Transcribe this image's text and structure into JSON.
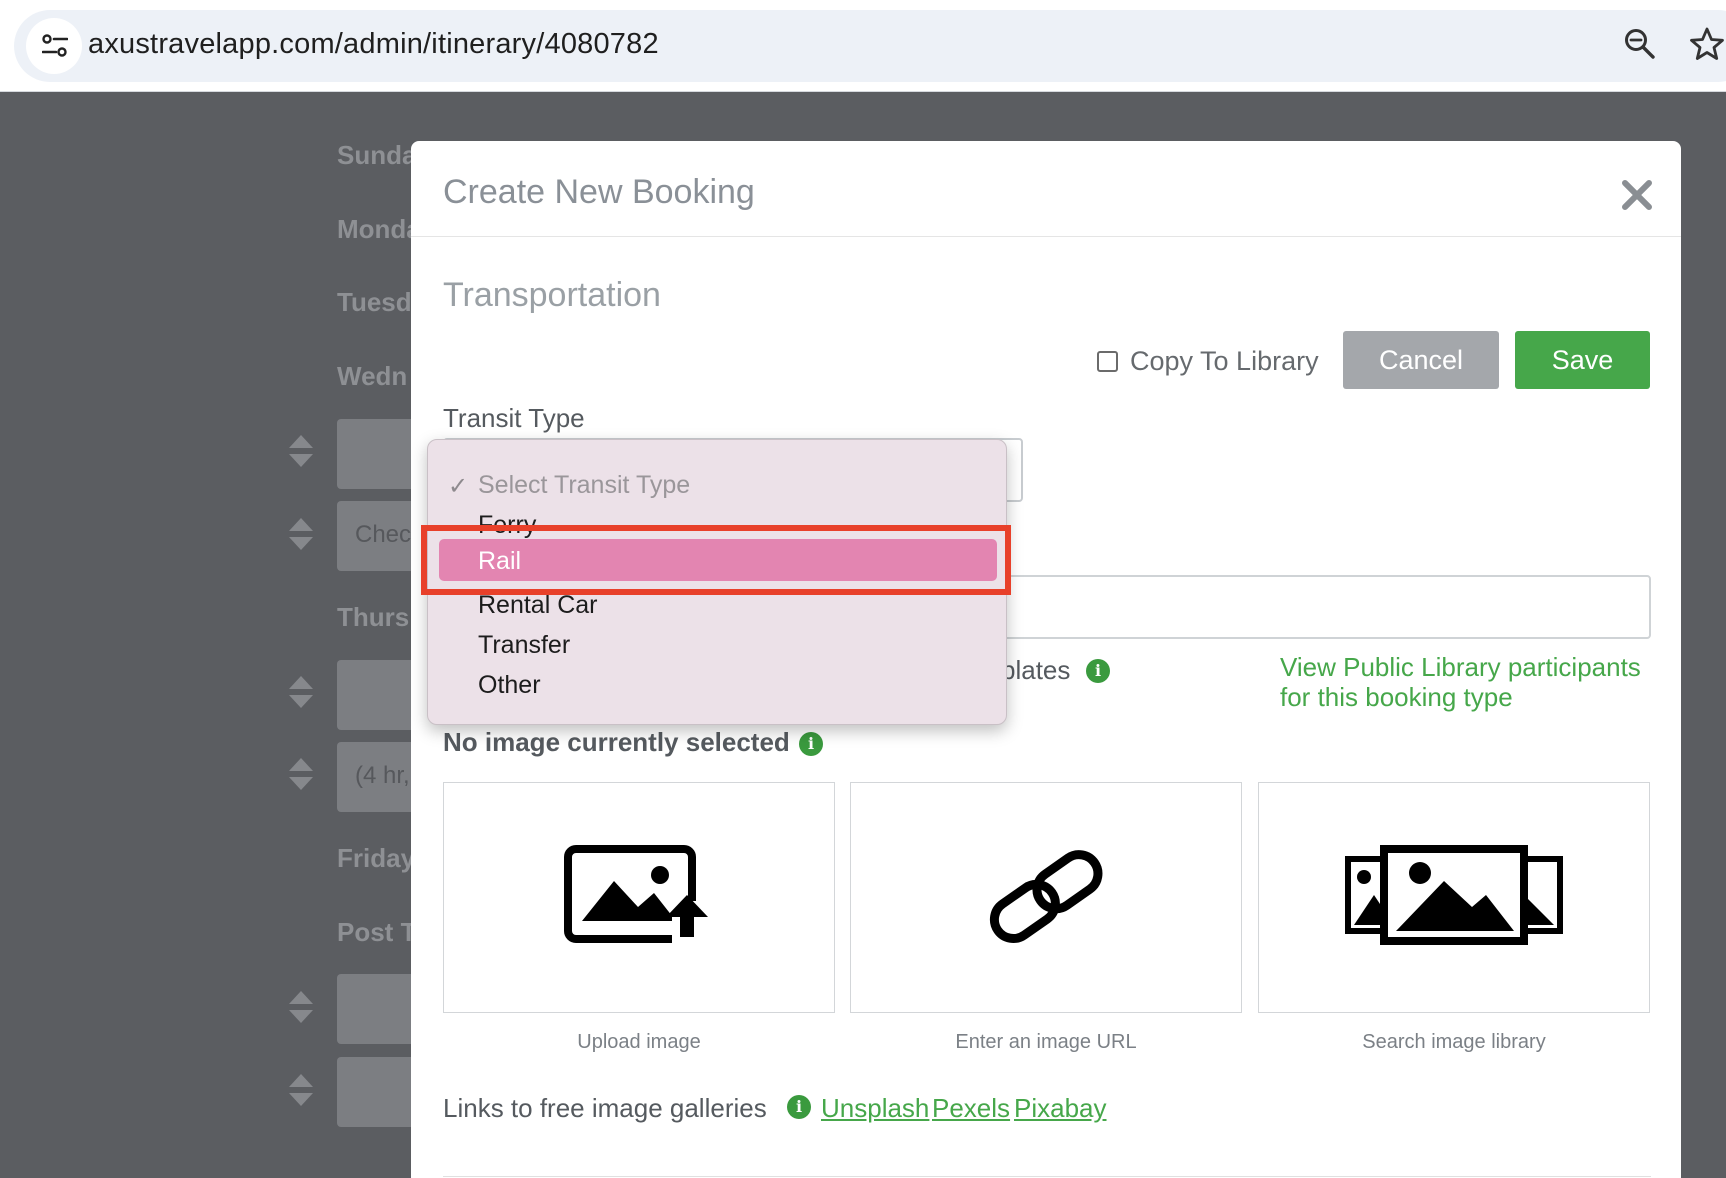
{
  "browser": {
    "url": "axustravelapp.com/admin/itinerary/4080782"
  },
  "background_page": {
    "days": [
      "Sunda",
      "Monda",
      "Tuesd",
      "Wedn",
      "Thurs",
      "Friday",
      "Post T"
    ],
    "box_texts": [
      "Chec",
      "(4 hr,"
    ]
  },
  "modal": {
    "title": "Create New Booking",
    "section_title": "Transportation",
    "copy_to_library_label": "Copy To Library",
    "cancel_label": "Cancel",
    "save_label": "Save",
    "transit_type_label": "Transit Type",
    "templates_text_partial": "plates",
    "public_library_link": "View Public Library participants for this booking type",
    "no_image_label": "No image currently selected",
    "image_options": [
      {
        "caption": "Upload image",
        "icon": "upload-image-icon"
      },
      {
        "caption": "Enter an image URL",
        "icon": "link-icon"
      },
      {
        "caption": "Search image library",
        "icon": "image-library-icon"
      }
    ],
    "gallery_links_label": "Links to free image galleries",
    "gallery_links": [
      "Unsplash",
      "Pexels",
      "Pixabay"
    ]
  },
  "transit_dropdown": {
    "placeholder": "Select Transit Type",
    "options": [
      "Ferry",
      "Rail",
      "Rental Car",
      "Transfer",
      "Other"
    ],
    "highlighted": "Rail"
  },
  "colors": {
    "accent_green": "#46a74a",
    "highlight_pink": "#e385b1",
    "annotation_red": "#e8402a"
  }
}
